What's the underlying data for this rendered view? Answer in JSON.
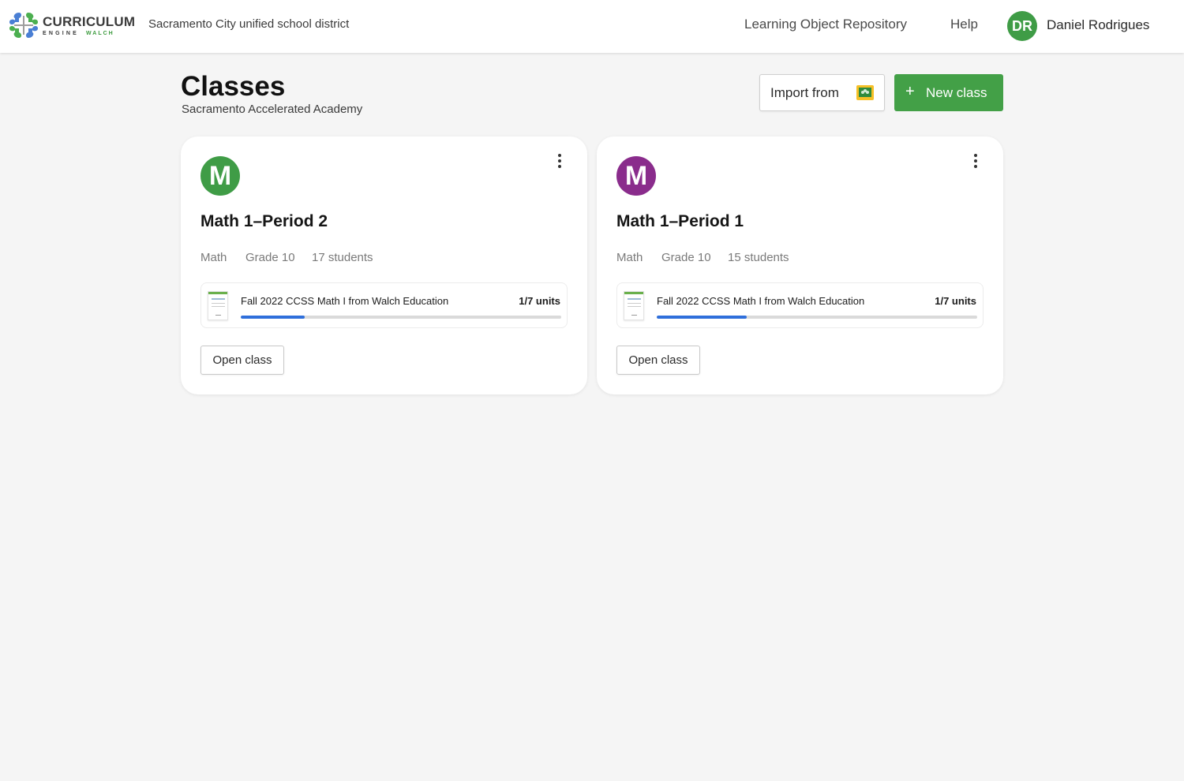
{
  "header": {
    "logo": {
      "main": "CURRICULUM",
      "engine": "ENGINE",
      "brand": "WALCH"
    },
    "district": "Sacramento City unified school district",
    "nav": [
      {
        "label": "Learning Object Repository"
      },
      {
        "label": "Help"
      }
    ],
    "user": {
      "initials": "DR",
      "name": "Daniel Rodrigues",
      "avatar_color": "#3f9c46"
    }
  },
  "page": {
    "title": "Classes",
    "subtitle": "Sacramento Accelerated Academy",
    "import_button": {
      "label": "Import from",
      "icon": "google-classroom-icon"
    },
    "new_class_button": {
      "label": "New class",
      "icon": "plus-icon",
      "plus": "+"
    }
  },
  "classes": [
    {
      "initial": "M",
      "avatar_color": "#3f9c46",
      "name": "Math 1–Period 2",
      "subject": "Math",
      "grade": "Grade 10",
      "students": "17 students",
      "curriculum": {
        "title": "Fall 2022 CCSS Math I from Walch Education",
        "units": "1/7 units",
        "progress": 0.2
      },
      "open_button": "Open class"
    },
    {
      "initial": "M",
      "avatar_color": "#8a2c8c",
      "name": "Math 1–Period 1",
      "subject": "Math",
      "grade": "Grade 10",
      "students": "15 students",
      "curriculum": {
        "title": "Fall 2022 CCSS Math I from Walch Education",
        "units": "1/7 units",
        "progress": 0.28
      },
      "open_button": "Open class"
    }
  ],
  "colors": {
    "accent_green": "#43a047",
    "progress_blue": "#2f6fdb",
    "background": "#f5f5f5"
  }
}
